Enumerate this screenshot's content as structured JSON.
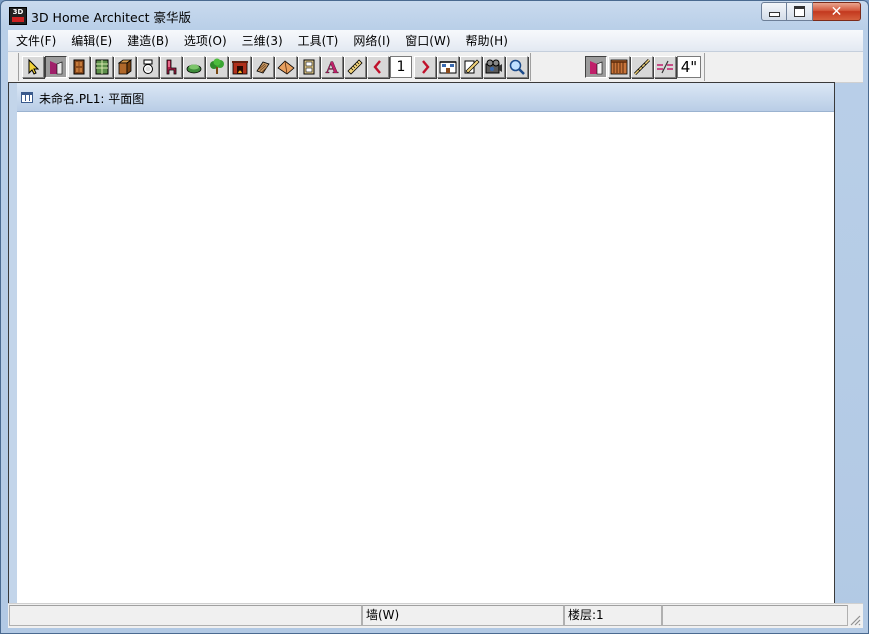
{
  "window": {
    "title": "3D Home Architect 豪华版",
    "app_icon_text": "3D",
    "close_symbol": "✕"
  },
  "menu": [
    "文件(F)",
    "编辑(E)",
    "建造(B)",
    "选项(O)",
    "三维(3)",
    "工具(T)",
    "网络(I)",
    "窗口(W)",
    "帮助(H)"
  ],
  "toolbar": {
    "tools": [
      {
        "icon": "select-arrow-icon"
      },
      {
        "icon": "wall-icon"
      },
      {
        "icon": "door-icon"
      },
      {
        "icon": "window-icon"
      },
      {
        "icon": "cabinet-icon"
      },
      {
        "icon": "toilet-icon"
      },
      {
        "icon": "chair-icon"
      },
      {
        "icon": "sofa-icon"
      },
      {
        "icon": "tree-icon"
      },
      {
        "icon": "fireplace-icon"
      },
      {
        "icon": "stairs-icon"
      },
      {
        "icon": "roof-icon"
      },
      {
        "icon": "appliance-icon"
      },
      {
        "icon": "text-icon",
        "glyph": "A"
      },
      {
        "icon": "ruler-icon"
      }
    ],
    "floor_prev_icon": "chevron-left-icon",
    "floor_number": "1",
    "floor_next_icon": "chevron-right-icon",
    "view_tools": [
      {
        "icon": "elevation-view-icon"
      },
      {
        "icon": "cross-section-icon"
      },
      {
        "icon": "camera-icon"
      },
      {
        "icon": "zoom-icon"
      }
    ],
    "wall_tools": [
      {
        "icon": "wall-active-icon",
        "pressed": true
      },
      {
        "icon": "railing-icon"
      },
      {
        "icon": "stair-wall-icon"
      },
      {
        "icon": "break-wall-icon"
      }
    ],
    "wall_thickness": "4\""
  },
  "document": {
    "title": "未命名.PL1: 平面图"
  },
  "status": {
    "cell1": "",
    "cell2": "墙(W)",
    "cell3": "楼层:1",
    "cell4": ""
  },
  "colors": {
    "title_gradient_top": "#c9daee",
    "doc_title_bar": "#b9cde6",
    "close_button": "#c3381e"
  }
}
